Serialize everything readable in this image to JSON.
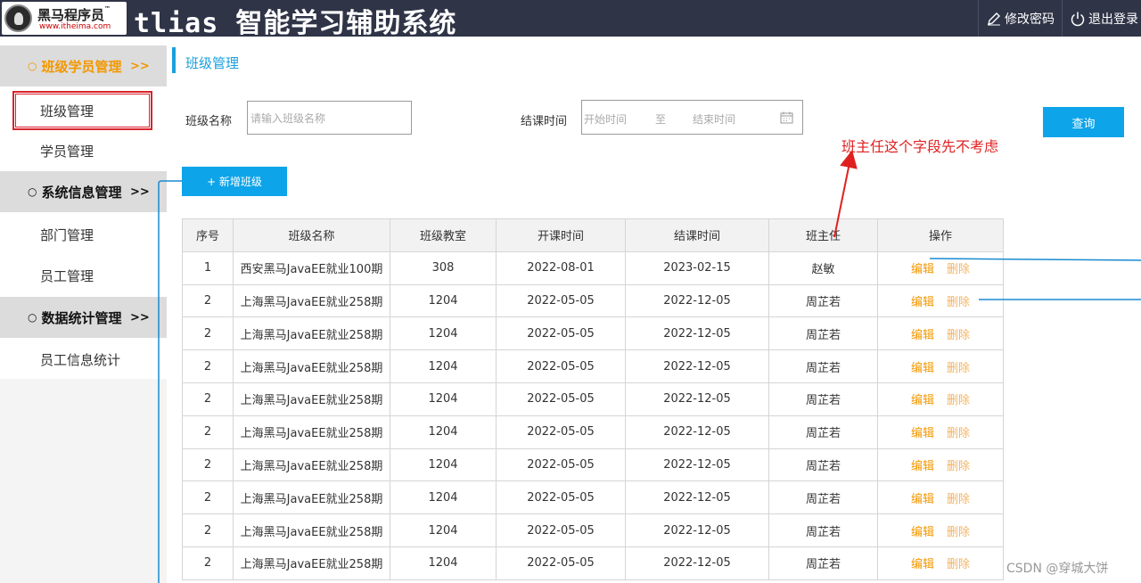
{
  "header": {
    "logo_cn": "黑马程序员",
    "logo_tm": "™",
    "logo_url": "www.itheima.com",
    "app_title": "tlias 智能学习辅助系统",
    "change_password": "修改密码",
    "logout": "退出登录",
    "bg_color": "#2f3447"
  },
  "sidebar": {
    "groups": [
      {
        "label": "班级学员管理",
        "arrow": ">>",
        "bullet": "○",
        "items": [
          "班级管理",
          "学员管理"
        ]
      },
      {
        "label": "系统信息管理",
        "arrow": ">>",
        "bullet": "○",
        "items": [
          "部门管理",
          "员工管理"
        ]
      },
      {
        "label": "数据统计管理",
        "arrow": ">>",
        "bullet": "○",
        "items": [
          "员工信息统计"
        ]
      }
    ],
    "active_color": "#f39800"
  },
  "breadcrumb": "班级管理",
  "search": {
    "class_name_label": "班级名称",
    "class_name_placeholder": "请输入班级名称",
    "end_time_label": "结课时间",
    "start_placeholder": "开始时间",
    "range_separator": "至",
    "end_placeholder": "结束时间",
    "query_button": "查询"
  },
  "add_button": "+ 新增班级",
  "annotation": "班主任这个字段先不考虑",
  "table": {
    "headers": [
      "序号",
      "班级名称",
      "班级教室",
      "开课时间",
      "结课时间",
      "班主任",
      "操作"
    ],
    "rows": [
      [
        "1",
        "西安黑马JavaEE就业100期",
        "308",
        "2022-08-01",
        "2023-02-15",
        "赵敏"
      ],
      [
        "2",
        "上海黑马JavaEE就业258期",
        "1204",
        "2022-05-05",
        "2022-12-05",
        "周芷若"
      ],
      [
        "2",
        "上海黑马JavaEE就业258期",
        "1204",
        "2022-05-05",
        "2022-12-05",
        "周芷若"
      ],
      [
        "2",
        "上海黑马JavaEE就业258期",
        "1204",
        "2022-05-05",
        "2022-12-05",
        "周芷若"
      ],
      [
        "2",
        "上海黑马JavaEE就业258期",
        "1204",
        "2022-05-05",
        "2022-12-05",
        "周芷若"
      ],
      [
        "2",
        "上海黑马JavaEE就业258期",
        "1204",
        "2022-05-05",
        "2022-12-05",
        "周芷若"
      ],
      [
        "2",
        "上海黑马JavaEE就业258期",
        "1204",
        "2022-05-05",
        "2022-12-05",
        "周芷若"
      ],
      [
        "2",
        "上海黑马JavaEE就业258期",
        "1204",
        "2022-05-05",
        "2022-12-05",
        "周芷若"
      ],
      [
        "2",
        "上海黑马JavaEE就业258期",
        "1204",
        "2022-05-05",
        "2022-12-05",
        "周芷若"
      ],
      [
        "2",
        "上海黑马JavaEE就业258期",
        "1204",
        "2022-05-05",
        "2022-12-05",
        "周芷若"
      ]
    ],
    "actions": {
      "edit": "编辑",
      "delete": "删除"
    }
  },
  "watermark": "CSDN @穿城大饼",
  "colors": {
    "accent": "#0ea4e9",
    "annotation": "#e02020",
    "selected_border": "#d9232c"
  }
}
